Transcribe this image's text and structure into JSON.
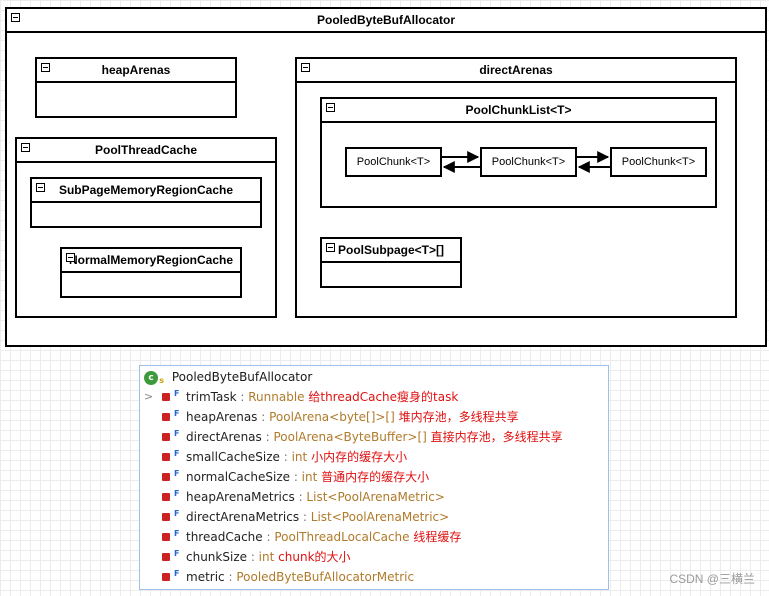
{
  "diagram": {
    "outer": {
      "title": "PooledByteBufAllocator"
    },
    "heap": {
      "title": "heapArenas"
    },
    "direct": {
      "title": "directArenas"
    },
    "chunk_list": {
      "title": "PoolChunkList<T>"
    },
    "chunks": [
      "PoolChunk<T>",
      "PoolChunk<T>",
      "PoolChunk<T>"
    ],
    "subpage": {
      "title": "PoolSubpage<T>[]"
    },
    "thread_cache": {
      "title": "PoolThreadCache"
    },
    "subpage_cache": {
      "title": "SubPageMemoryRegionCache"
    },
    "normal_cache": {
      "title": "NormalMemoryRegionCache"
    }
  },
  "structure": {
    "class_name": "PooledByteBufAllocator",
    "class_icon": "class-icon",
    "fields": [
      {
        "name": "trimTask",
        "sep": " : ",
        "type": "Runnable",
        "comment": "给threadCache瘦身的task",
        "expandable": true
      },
      {
        "name": "heapArenas",
        "sep": " : ",
        "type": "PoolArena<byte[]>[]",
        "comment": "堆内存池，多线程共享",
        "expandable": false
      },
      {
        "name": "directArenas",
        "sep": " : ",
        "type": "PoolArena<ByteBuffer>[]",
        "comment": "直接内存池，多线程共享",
        "expandable": false
      },
      {
        "name": "smallCacheSize",
        "sep": " : ",
        "type": "int",
        "comment": "小内存的缓存大小",
        "expandable": false
      },
      {
        "name": "normalCacheSize",
        "sep": " : ",
        "type": "int",
        "comment": "普通内存的缓存大小",
        "expandable": false
      },
      {
        "name": "heapArenaMetrics",
        "sep": " : ",
        "type": "List<PoolArenaMetric>",
        "comment": "",
        "expandable": false
      },
      {
        "name": "directArenaMetrics",
        "sep": " : ",
        "type": "List<PoolArenaMetric>",
        "comment": "",
        "expandable": false
      },
      {
        "name": "threadCache",
        "sep": " : ",
        "type": "PoolThreadLocalCache",
        "comment": "线程缓存",
        "expandable": false
      },
      {
        "name": "chunkSize",
        "sep": " : ",
        "type": "int",
        "comment": "chunk的大小",
        "expandable": false
      },
      {
        "name": "metric",
        "sep": " : ",
        "type": "PooledByteBufAllocatorMetric",
        "comment": "",
        "expandable": false
      }
    ]
  },
  "watermark": "CSDN @三横兰"
}
